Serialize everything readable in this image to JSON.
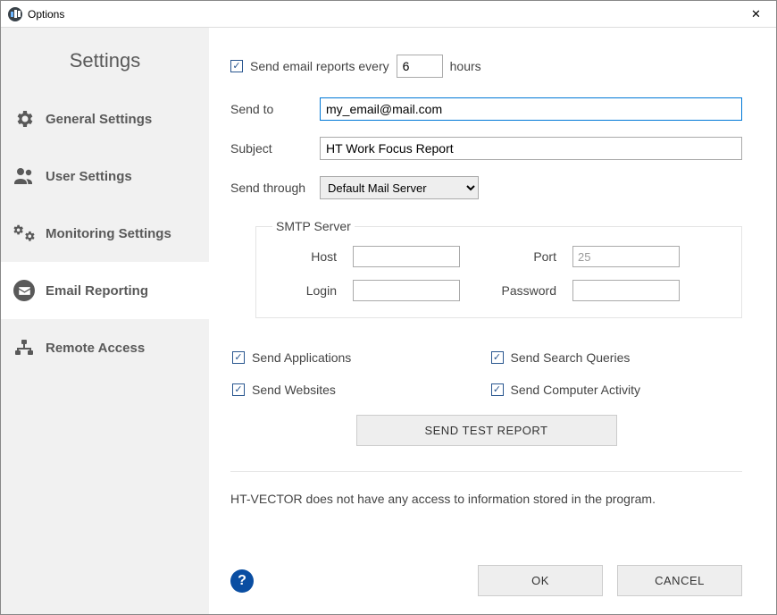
{
  "window": {
    "title": "Options"
  },
  "sidebar": {
    "title": "Settings",
    "items": [
      {
        "label": "General Settings"
      },
      {
        "label": "User Settings"
      },
      {
        "label": "Monitoring Settings"
      },
      {
        "label": "Email Reporting"
      },
      {
        "label": "Remote Access"
      }
    ]
  },
  "form": {
    "send_every_label_pre": "Send email reports every",
    "send_every_value": "6",
    "send_every_label_post": "hours",
    "send_to_label": "Send to",
    "send_to_value": "my_email@mail.com",
    "subject_label": "Subject",
    "subject_value": "HT Work Focus Report",
    "send_through_label": "Send through",
    "send_through_value": "Default Mail Server",
    "smtp": {
      "legend": "SMTP Server",
      "host_label": "Host",
      "host_value": "",
      "port_label": "Port",
      "port_value": "25",
      "login_label": "Login",
      "login_value": "",
      "password_label": "Password",
      "password_value": ""
    },
    "options": {
      "send_apps": "Send Applications",
      "send_queries": "Send Search Queries",
      "send_websites": "Send Websites",
      "send_activity": "Send Computer Activity"
    },
    "test_button": "SEND TEST REPORT",
    "disclaimer": "HT-VECTOR does not have any access to information stored in the program."
  },
  "footer": {
    "ok": "OK",
    "cancel": "CANCEL"
  }
}
